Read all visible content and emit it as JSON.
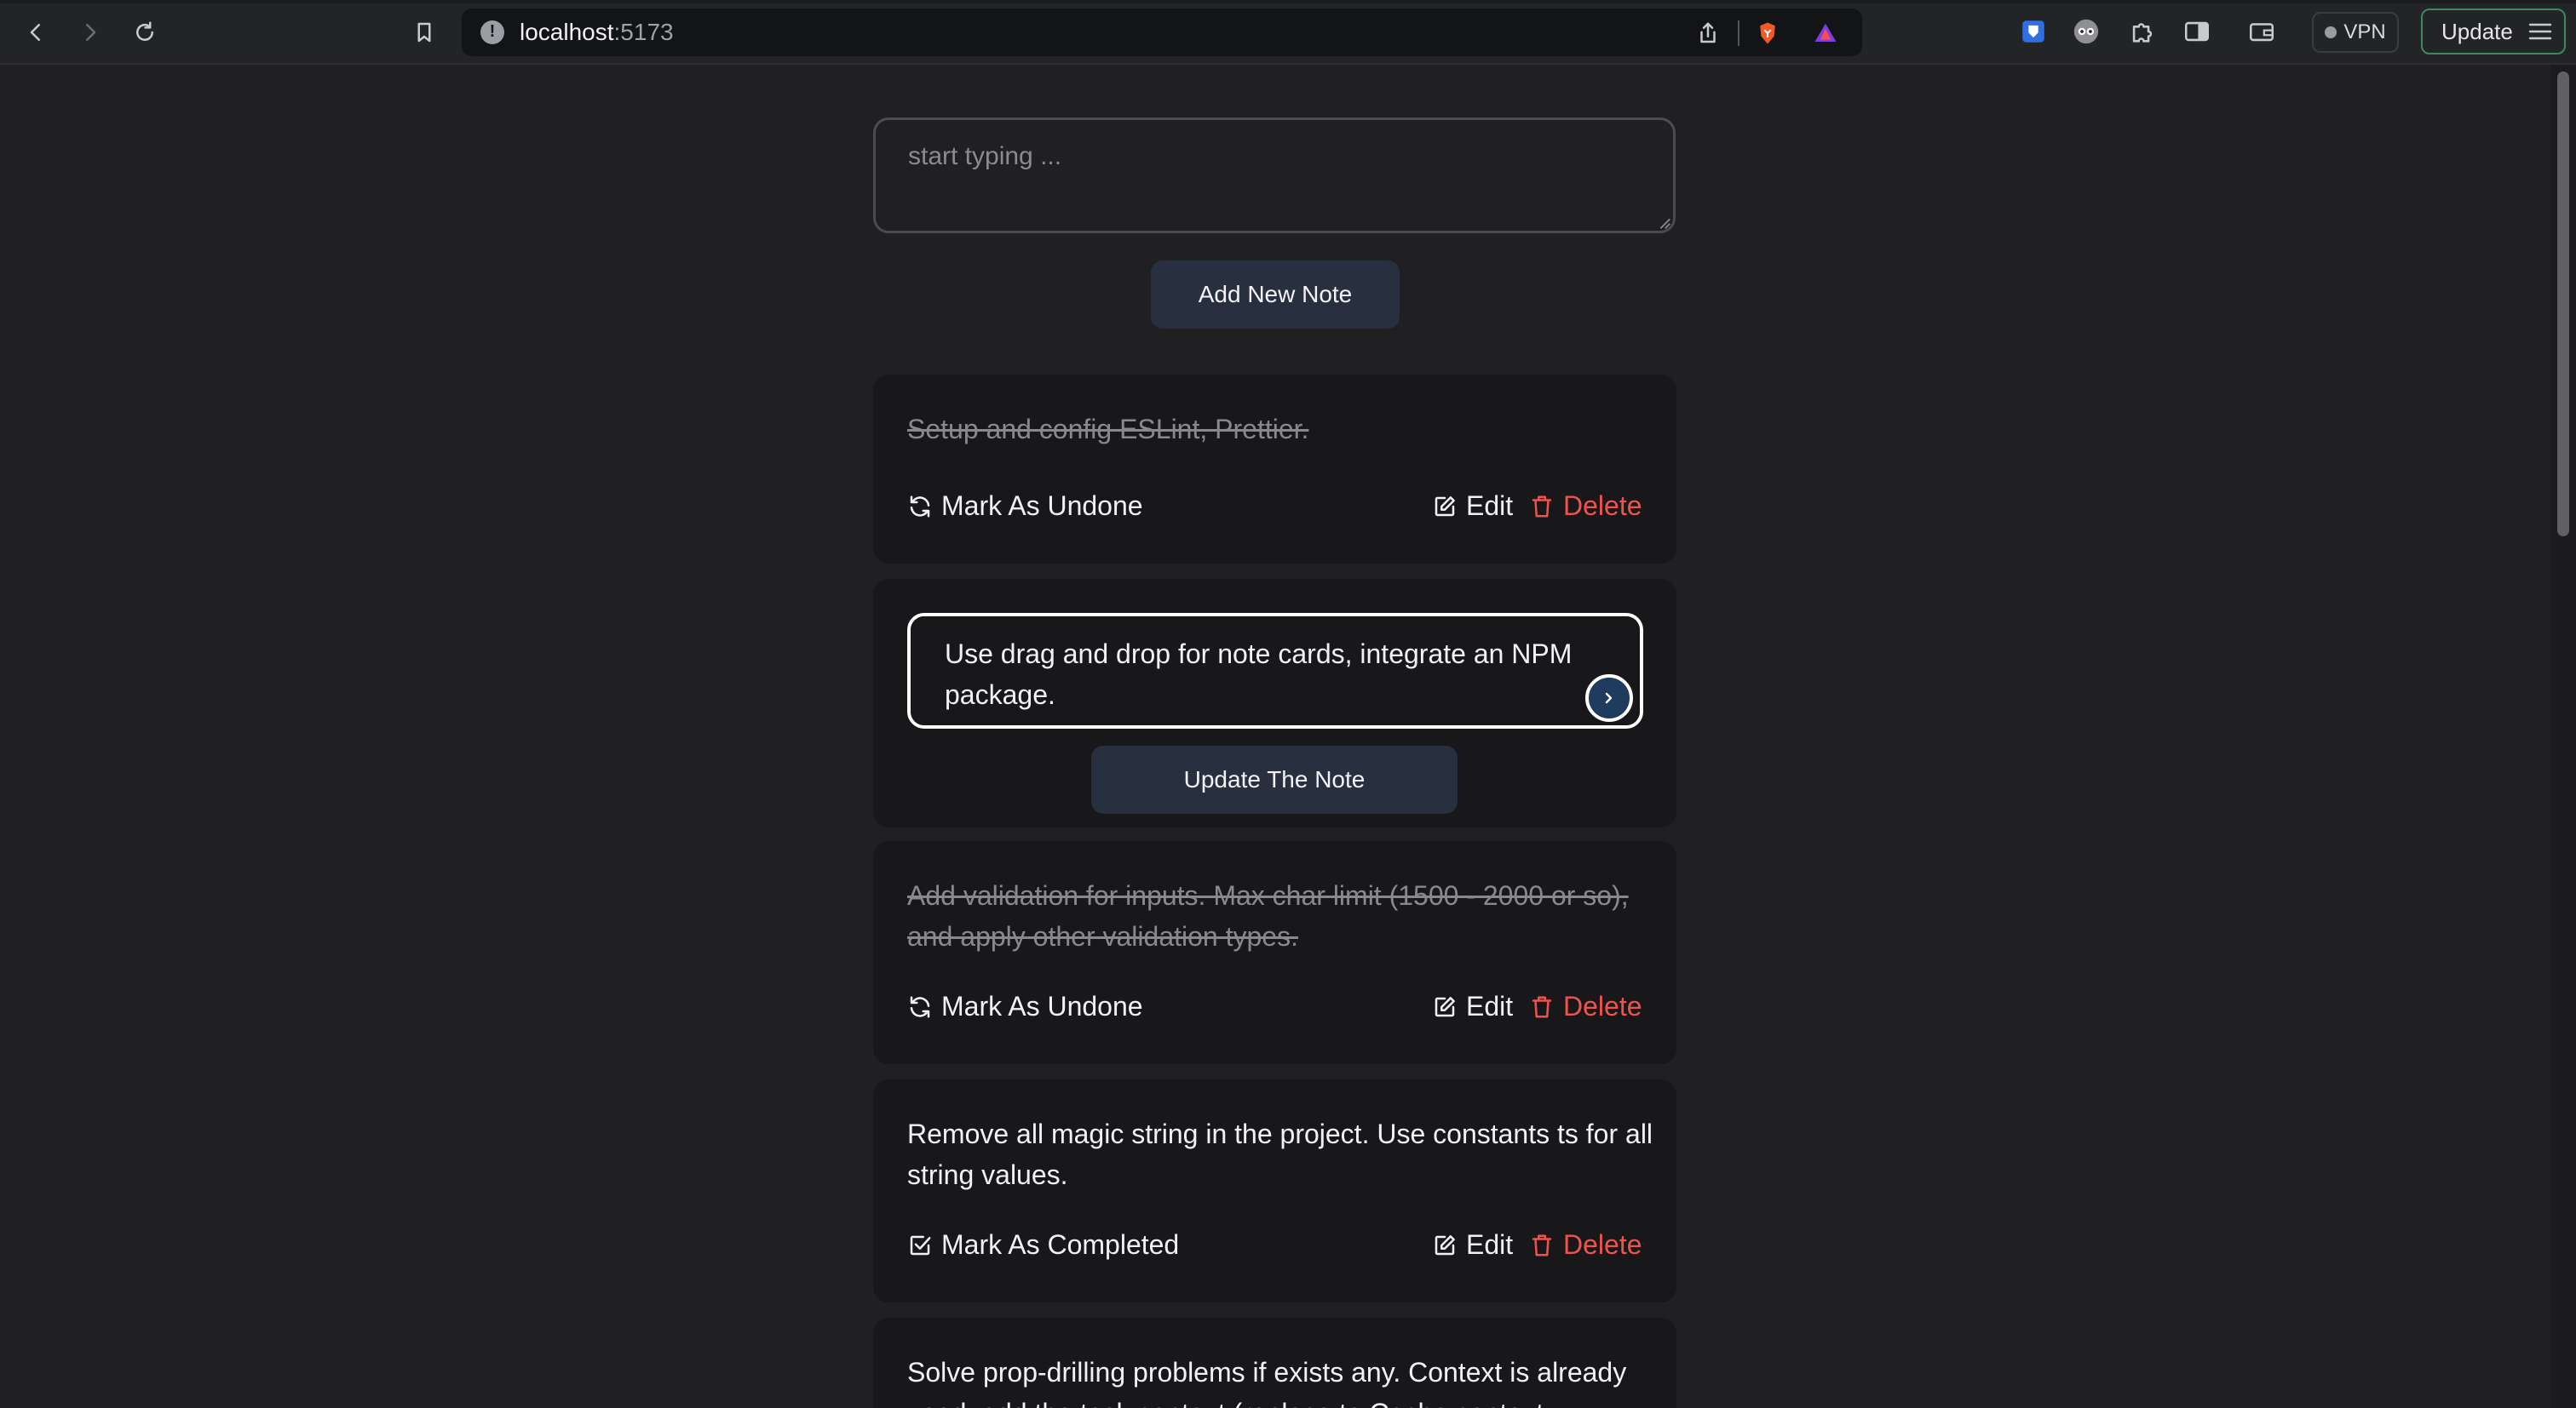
{
  "browser": {
    "url_host": "localhost",
    "url_port": ":5173",
    "vpn_label": "VPN",
    "update_label": "Update"
  },
  "composer": {
    "placeholder": "start typing ...",
    "add_label": "Add New Note"
  },
  "notes": [
    {
      "text": "Setup and config ESLint, Prettier.",
      "completed": true,
      "toggle_label": "Mark As Undone",
      "edit_label": "Edit",
      "delete_label": "Delete"
    },
    {
      "editing": true,
      "edit_value": "Use drag and drop for note cards, integrate an NPM package.",
      "update_label": "Update The Note"
    },
    {
      "text": "Add validation for inputs. Max char limit (1500 - 2000 or so), and apply other validation types.",
      "completed": true,
      "toggle_label": "Mark As Undone",
      "edit_label": "Edit",
      "delete_label": "Delete"
    },
    {
      "text": "Remove all magic string in the project. Use constants ts for all string values.",
      "completed": false,
      "toggle_label": "Mark As Completed",
      "edit_label": "Edit",
      "delete_label": "Delete"
    },
    {
      "text": "Solve prop-drilling problems if exists any. Context is already used, add the task context (replace te Cache context"
    }
  ],
  "colors": {
    "background": "#202023",
    "card": "#18181b",
    "button": "#283040",
    "delete": "#ef5350",
    "completed_text": "#88898e"
  }
}
